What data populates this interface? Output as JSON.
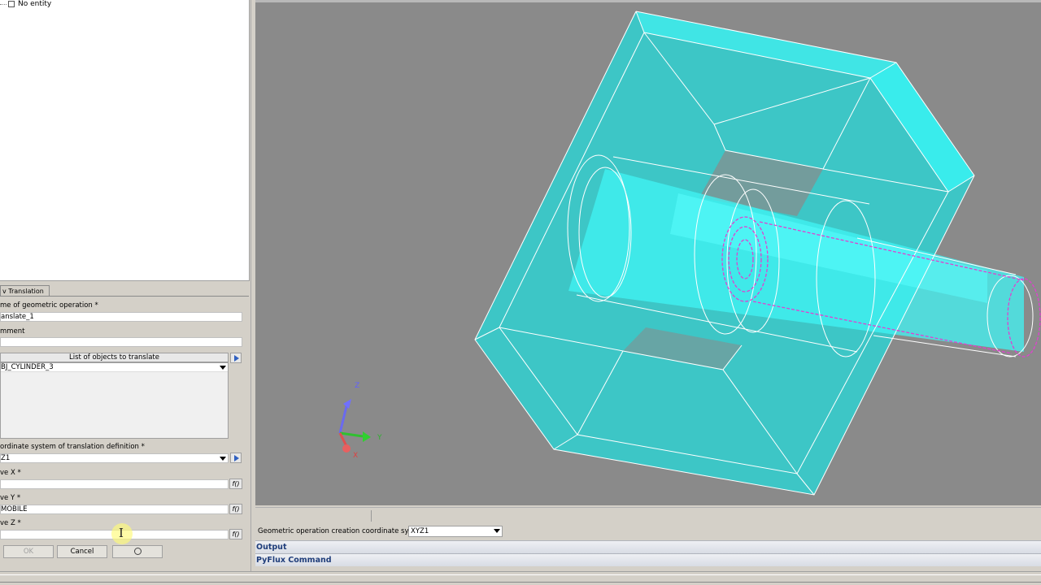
{
  "entity_tree": {
    "empty_label": "No entity"
  },
  "form": {
    "tab_label": "v Translation",
    "name_label": "me of geometric operation *",
    "name_value": "anslate_1",
    "comment_label": "mment",
    "comment_value": "",
    "objects_header": "List of objects to translate",
    "objects_selected": "BJ_CYLINDER_3",
    "coordsys_label": "ordinate system of translation definition *",
    "coordsys_value": "Z1",
    "x_label": "ve X *",
    "x_value": "",
    "y_label": "ve Y *",
    "y_value": "MOBILE",
    "z_label": "ve Z *",
    "z_value": "",
    "f_button": "f()",
    "ok_label": "OK",
    "cancel_label": "Cancel"
  },
  "viewport": {
    "axis_labels": {
      "z": "Z",
      "x": "X",
      "y": "Y"
    },
    "colors": {
      "background": "#8a8a8a",
      "solid": "#35e6e6",
      "edges": "#ffffff",
      "selected": "#e040d0"
    }
  },
  "coord_bar": {
    "label": "Geometric operation creation coordinate system:",
    "value": "XYZ1"
  },
  "docks": {
    "output": "Output",
    "pyflux": "PyFlux Command"
  }
}
